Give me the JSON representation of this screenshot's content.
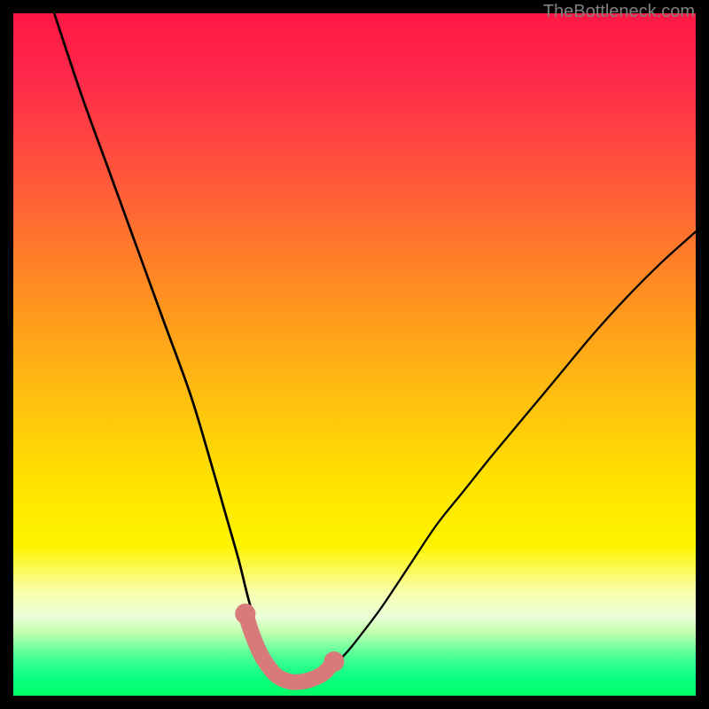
{
  "attribution": "TheBottleneck.com",
  "colors": {
    "frame": "#000000",
    "gradient_stops": [
      {
        "pos": 0.0,
        "color": "#ff1744"
      },
      {
        "pos": 0.1,
        "color": "#ff2a4a"
      },
      {
        "pos": 0.25,
        "color": "#ff5a3a"
      },
      {
        "pos": 0.4,
        "color": "#ff8c22"
      },
      {
        "pos": 0.55,
        "color": "#ffbb11"
      },
      {
        "pos": 0.68,
        "color": "#ffe100"
      },
      {
        "pos": 0.78,
        "color": "#fff400"
      },
      {
        "pos": 0.85,
        "color": "#f8ffb0"
      },
      {
        "pos": 0.885,
        "color": "#eaffd8"
      },
      {
        "pos": 0.905,
        "color": "#c6ffb0"
      },
      {
        "pos": 0.918,
        "color": "#9dffa8"
      },
      {
        "pos": 0.93,
        "color": "#72ff9e"
      },
      {
        "pos": 0.945,
        "color": "#47ff94"
      },
      {
        "pos": 0.96,
        "color": "#22ff8a"
      },
      {
        "pos": 0.975,
        "color": "#0aff80"
      },
      {
        "pos": 1.0,
        "color": "#00ff66"
      }
    ],
    "curve": "#000000",
    "highlight": "#d87a7a"
  },
  "chart_data": {
    "type": "line",
    "title": "",
    "xlabel": "",
    "ylabel": "",
    "xlim": [
      0,
      100
    ],
    "ylim": [
      0,
      100
    ],
    "series": [
      {
        "name": "left-curve",
        "x": [
          6,
          10,
          14,
          18,
          22,
          26,
          29,
          31,
          33,
          34.5,
          36,
          37.5,
          38.5,
          39.2,
          40,
          41
        ],
        "y": [
          100,
          88,
          77,
          66,
          55,
          44,
          34,
          27,
          20,
          14,
          9,
          5.5,
          3.5,
          2.5,
          2,
          2
        ]
      },
      {
        "name": "right-curve",
        "x": [
          41,
          43,
          45,
          47,
          49,
          51,
          54,
          58,
          62,
          66,
          70,
          75,
          80,
          85,
          90,
          95,
          100
        ],
        "y": [
          2,
          2.2,
          3,
          4.5,
          6.5,
          9,
          13,
          19,
          25,
          30,
          35,
          41,
          47,
          53,
          58.5,
          63.5,
          68
        ]
      }
    ],
    "highlight_segment": {
      "name": "valley-highlight",
      "x": [
        34,
        35.2,
        36.4,
        37.6,
        38.5,
        39.5,
        41,
        43,
        45,
        46,
        47
      ],
      "y": [
        12,
        8.5,
        5.8,
        4,
        3,
        2.4,
        2,
        2.2,
        3,
        3.8,
        5
      ]
    }
  }
}
